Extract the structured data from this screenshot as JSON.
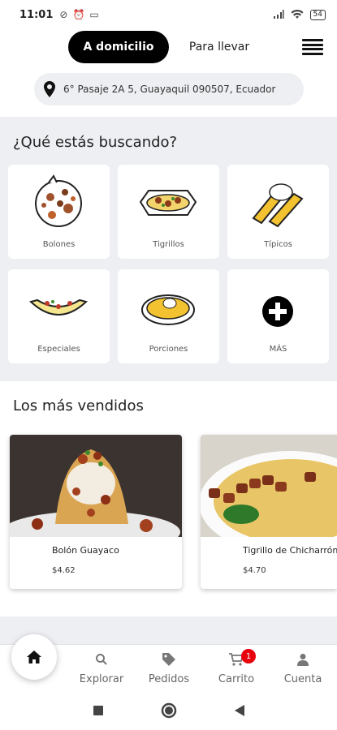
{
  "status_bar": {
    "time": "11:01",
    "battery": "54"
  },
  "header": {
    "delivery_label": "A domicilio",
    "pickup_label": "Para llevar",
    "address": "6° Pasaje 2A 5, Guayaquil 090507, Ecuador"
  },
  "categories_section": {
    "title": "¿Qué estás buscando?",
    "items": [
      {
        "label": "Bolones"
      },
      {
        "label": "Tigrillos"
      },
      {
        "label": "Típicos"
      },
      {
        "label": "Especiales"
      },
      {
        "label": "Porciones"
      },
      {
        "label": "MÁS"
      }
    ]
  },
  "best_sellers": {
    "title": "Los más vendidos",
    "products": [
      {
        "name": "Bolón Guayaco",
        "price": "$4.62"
      },
      {
        "name": "Tigrillo de Chicharrón",
        "price": "$4.70"
      }
    ]
  },
  "bottom_nav": {
    "items": [
      {
        "label": "Explorar"
      },
      {
        "label": "Pedidos"
      },
      {
        "label": "Carrito"
      },
      {
        "label": "Cuenta"
      }
    ],
    "cart_count": "1"
  },
  "colors": {
    "primary": "#000000",
    "badge": "#e8000d",
    "background": "#eeeff3"
  }
}
